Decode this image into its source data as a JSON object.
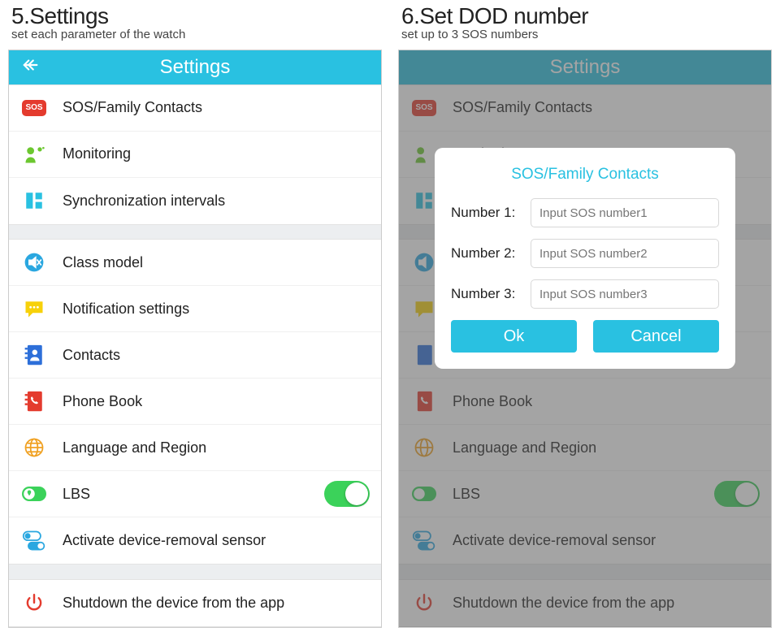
{
  "left": {
    "section_number": "5.",
    "section_title": "Settings",
    "section_sub": "set each parameter of the watch",
    "header": "Settings",
    "sos_badge": "SOS",
    "items": [
      {
        "label": "SOS/Family Contacts"
      },
      {
        "label": "Monitoring"
      },
      {
        "label": "Synchronization intervals"
      },
      {
        "label": "Class model"
      },
      {
        "label": "Notification settings"
      },
      {
        "label": "Contacts"
      },
      {
        "label": "Phone Book"
      },
      {
        "label": "Language and Region"
      },
      {
        "label": "LBS"
      },
      {
        "label": "Activate device-removal sensor"
      },
      {
        "label": "Shutdown the device from the app"
      }
    ],
    "lbs_toggle_on": true
  },
  "right": {
    "section_number": "6.",
    "section_title": "Set DOD number",
    "section_sub": "set up to 3 SOS numbers",
    "header": "Settings",
    "modal": {
      "title": "SOS/Family Contacts",
      "fields": [
        {
          "label": "Number 1:",
          "placeholder": "Input SOS number1"
        },
        {
          "label": "Number 2:",
          "placeholder": "Input SOS number2"
        },
        {
          "label": "Number 3:",
          "placeholder": "Input SOS number3"
        }
      ],
      "ok": "Ok",
      "cancel": "Cancel"
    }
  }
}
